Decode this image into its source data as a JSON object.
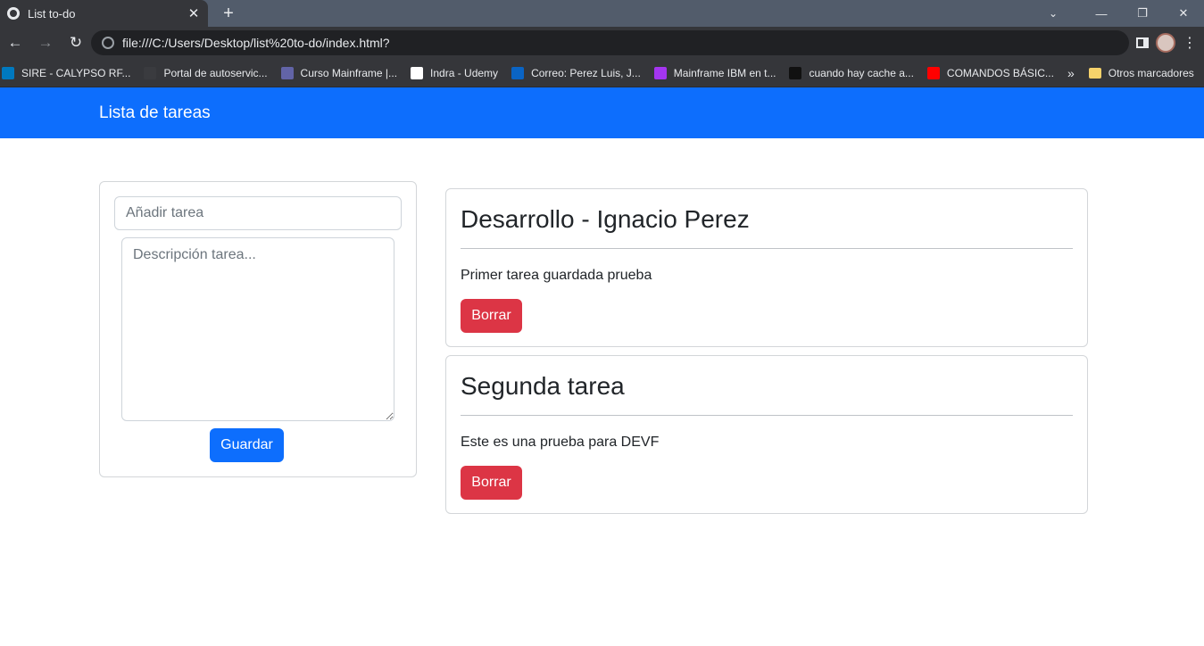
{
  "browser": {
    "tab": {
      "title": "List to-do",
      "close": "✕"
    },
    "new_tab": "+",
    "window": {
      "tabsearch": "⌄",
      "minimize": "—",
      "restore": "❐",
      "close": "✕"
    },
    "nav": {
      "back": "←",
      "forward": "→",
      "reload": "↻",
      "menu": "⋮"
    },
    "url": "file:///C:/Users/Desktop/list%20to-do/index.html?",
    "bookmarks": [
      {
        "label": "SIRE - CALYPSO RF...",
        "icon": "trello-icon",
        "color": "#0079bf"
      },
      {
        "label": "Portal de autoservic...",
        "icon": "portal-icon",
        "color": "#3a3b3f"
      },
      {
        "label": "Curso Mainframe |...",
        "icon": "teams-icon",
        "color": "#6264a7"
      },
      {
        "label": "Indra - Udemy",
        "icon": "indra-icon",
        "color": "#ffffff"
      },
      {
        "label": "Correo: Perez Luis, J...",
        "icon": "outlook-icon",
        "color": "#0a64c4"
      },
      {
        "label": "Mainframe IBM en t...",
        "icon": "udemy-icon",
        "color": "#a435f0"
      },
      {
        "label": "cuando hay cache a...",
        "icon": "github-icon",
        "color": "#111111"
      },
      {
        "label": "COMANDOS BÁSIC...",
        "icon": "youtube-icon",
        "color": "#ff0000"
      }
    ],
    "bookmarks_more": "»",
    "other_bookmarks": "Otros marcadores"
  },
  "navbar": {
    "brand": "Lista de tareas",
    "color": "#0d6efd"
  },
  "form": {
    "title_placeholder": "Añadir tarea",
    "description_placeholder": "Descripción tarea...",
    "save_label": "Guardar"
  },
  "tasks": [
    {
      "title": "Desarrollo - Ignacio Perez",
      "description": "Primer tarea guardada prueba",
      "delete_label": "Borrar"
    },
    {
      "title": "Segunda tarea",
      "description": "Este es una prueba para DEVF",
      "delete_label": "Borrar"
    }
  ],
  "colors": {
    "primary": "#0d6efd",
    "danger": "#dc3545"
  }
}
